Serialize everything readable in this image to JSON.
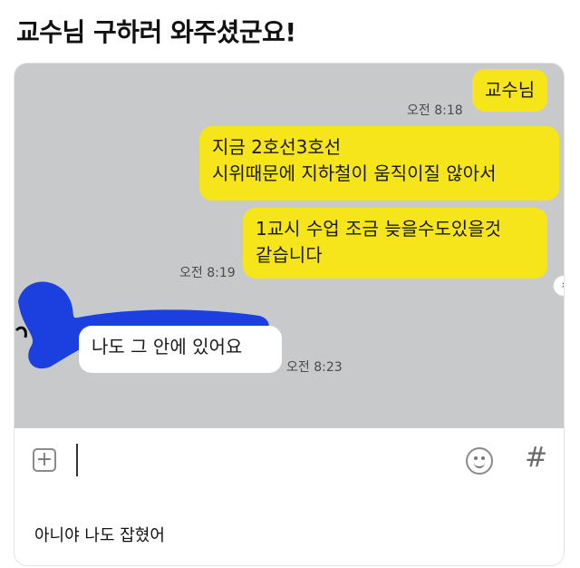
{
  "post": {
    "title": "교수님 구하러 와주셨군요!"
  },
  "chat": {
    "messages": [
      {
        "sender": "me",
        "lines": [
          "교수님"
        ],
        "time": "오전 8:18"
      },
      {
        "sender": "me",
        "lines": [
          "지금 2호선3호선",
          "시위때문에 지하철이 움직이질 않아서"
        ],
        "time": ""
      },
      {
        "sender": "me",
        "lines": [
          "1교시 수업 조금 늦을수도있을것",
          "같습니다"
        ],
        "time": "오전 8:19"
      },
      {
        "sender": "other",
        "lines": [
          "나도 그 안에 있어요"
        ],
        "time": "오전 8:23"
      }
    ],
    "colors": {
      "background": "#c8c9cb",
      "my_bubble": "#f6e51b",
      "other_bubble": "#ffffff",
      "redaction": "#1c3fe0"
    }
  },
  "composer": {
    "plus_icon": "plus-square-icon",
    "emoji_icon": "smiley-icon",
    "hash_icon": "hash-icon",
    "hash_glyph": "#"
  },
  "caption": {
    "text": "아니야 나도 잡혔어"
  }
}
